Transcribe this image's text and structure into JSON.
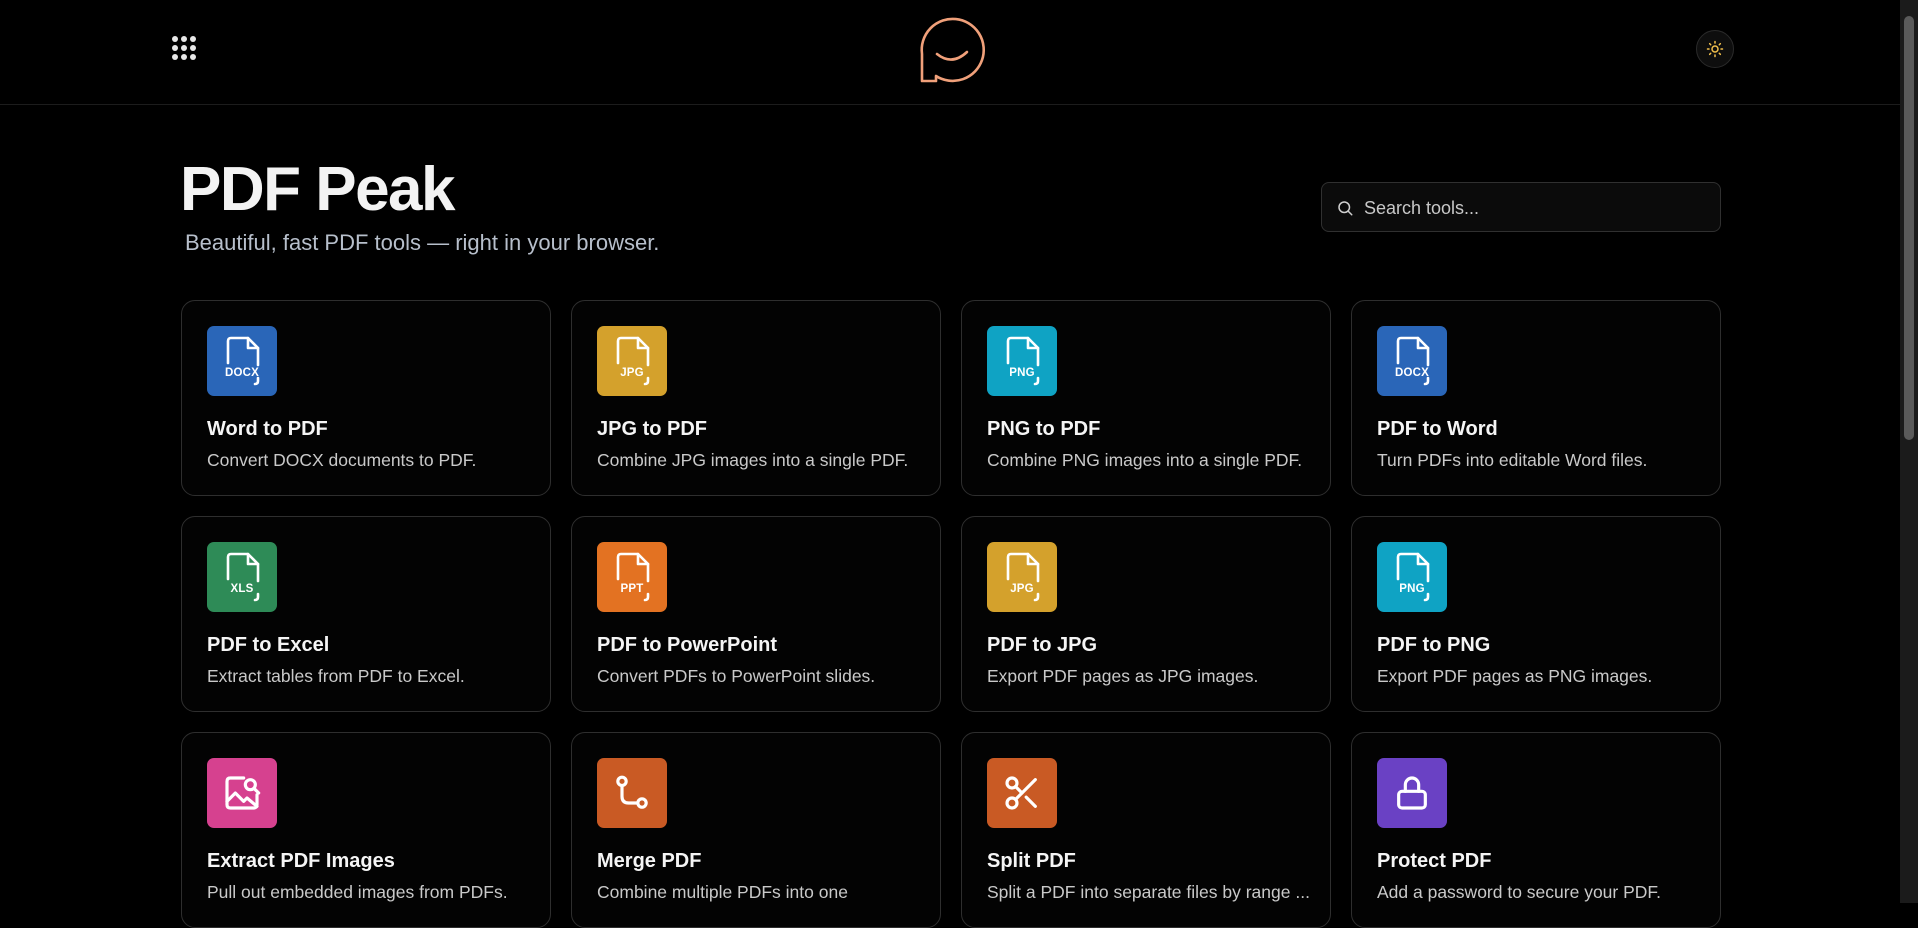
{
  "header": {
    "apps_icon": "grid-dots-icon",
    "logo_icon": "smile-bubble-logo-icon",
    "theme_icon": "sun-icon",
    "accent": "#f0a07a"
  },
  "hero": {
    "title": "PDF Peak",
    "subtitle": "Beautiful, fast PDF tools — right in your browser."
  },
  "search": {
    "placeholder": "Search tools..."
  },
  "tools": [
    {
      "name": "Word to PDF",
      "desc": "Convert DOCX documents to PDF.",
      "icon": "file-icon",
      "badge": "DOCX",
      "color": "#2a66b8"
    },
    {
      "name": "JPG to PDF",
      "desc": "Combine JPG images into a single PDF.",
      "icon": "file-icon",
      "badge": "JPG",
      "color": "#d4a12c"
    },
    {
      "name": "PNG to PDF",
      "desc": "Combine PNG images into a single PDF.",
      "icon": "file-icon",
      "badge": "PNG",
      "color": "#0fa3c4"
    },
    {
      "name": "PDF to Word",
      "desc": "Turn PDFs into editable Word files.",
      "icon": "file-icon",
      "badge": "DOCX",
      "color": "#2a66b8"
    },
    {
      "name": "PDF to Excel",
      "desc": "Extract tables from PDF to Excel.",
      "icon": "file-icon",
      "badge": "XLS",
      "color": "#2e8b57"
    },
    {
      "name": "PDF to PowerPoint",
      "desc": "Convert PDFs to PowerPoint slides.",
      "icon": "file-icon",
      "badge": "PPT",
      "color": "#e37222"
    },
    {
      "name": "PDF to JPG",
      "desc": "Export PDF pages as JPG images.",
      "icon": "file-icon",
      "badge": "JPG",
      "color": "#d4a12c"
    },
    {
      "name": "PDF to PNG",
      "desc": "Export PDF pages as PNG images.",
      "icon": "file-icon",
      "badge": "PNG",
      "color": "#0fa3c4"
    },
    {
      "name": "Extract PDF Images",
      "desc": "Pull out embedded images from PDFs.",
      "icon": "image-search-icon",
      "badge": "",
      "color": "#d6418f"
    },
    {
      "name": "Merge PDF",
      "desc": "Combine multiple PDFs into one",
      "icon": "git-merge-icon",
      "badge": "",
      "color": "#c95a24"
    },
    {
      "name": "Split PDF",
      "desc": "Split a PDF into separate files by range ...",
      "icon": "scissors-icon",
      "badge": "",
      "color": "#c95a24"
    },
    {
      "name": "Protect PDF",
      "desc": "Add a password to secure your PDF.",
      "icon": "lock-icon",
      "badge": "",
      "color": "#6a41c4"
    }
  ]
}
